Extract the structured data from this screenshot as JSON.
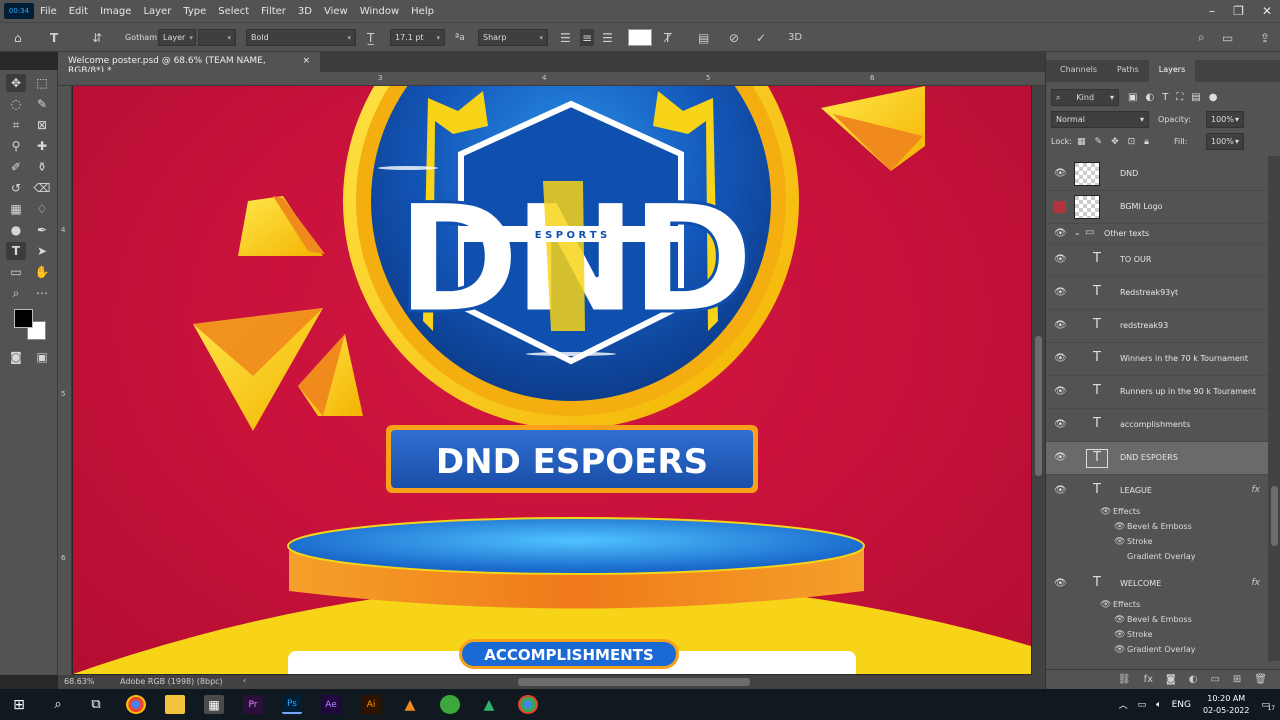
{
  "app": {
    "time_badge": "00:34",
    "menu": [
      "File",
      "Edit",
      "Image",
      "Layer",
      "Type",
      "Select",
      "Filter",
      "3D",
      "View",
      "Window",
      "Help"
    ]
  },
  "options": {
    "font_family": "Gotham",
    "font_family_style": "Layer",
    "font_style": "Bold",
    "font_size": "17.1 pt",
    "antialias": "Sharp",
    "text_color": "#ffffff"
  },
  "document": {
    "tab_title": "Welcome poster.psd @ 68.6% (TEAM NAME, RGB/8*) *",
    "zoom": "68.63%",
    "color_profile": "Adobe RGB (1998) (8bpc)",
    "ruler_top": [
      "3",
      "4",
      "5",
      "6"
    ],
    "ruler_left": [
      "4",
      "5",
      "6"
    ]
  },
  "poster": {
    "logo_letters": "DND",
    "logo_sub": "E S P O R T S",
    "team_name": "DND ESPOERS",
    "section_heading": "ACCOMPLISHMENTS",
    "colors": {
      "background": "#c9123b",
      "yellow": "#f7d417",
      "orange": "#f08a1c",
      "blue": "#1357b9"
    }
  },
  "panels": {
    "tabs": [
      "Channels",
      "Paths",
      "Layers"
    ],
    "filter_kind": "Kind",
    "blend_mode": "Normal",
    "opacity_label": "Opacity:",
    "opacity": "100%",
    "lock_label": "Lock:",
    "fill_label": "Fill:",
    "fill": "100%"
  },
  "layers": [
    {
      "name": "DND",
      "type": "smart"
    },
    {
      "name": "BGMI Logo",
      "type": "smart"
    },
    {
      "name": "Other texts",
      "type": "group"
    },
    {
      "name": "TO OUR",
      "type": "text"
    },
    {
      "name": "Redstreak93yt",
      "type": "text"
    },
    {
      "name": "redstreak93",
      "type": "text"
    },
    {
      "name": "Winners in the 70 k Tournament",
      "type": "text"
    },
    {
      "name": "Runners up in the 90 k Tourament",
      "type": "text"
    },
    {
      "name": "accomplishments",
      "type": "text"
    },
    {
      "name": "DND ESPOERS",
      "type": "text"
    },
    {
      "name": "LEAGUE",
      "type": "text"
    },
    {
      "name": "WELCOME",
      "type": "text"
    }
  ],
  "effects_label": "Effects",
  "effects": [
    "Bevel & Emboss",
    "Stroke",
    "Gradient Overlay"
  ],
  "fx_badge": "fx",
  "taskbar": {
    "lang": "ENG",
    "time": "10:20 AM",
    "date": "02-05-2022",
    "notif_count": "17",
    "apps": [
      "Pr",
      "Ps",
      "Ae",
      "Ai"
    ]
  }
}
